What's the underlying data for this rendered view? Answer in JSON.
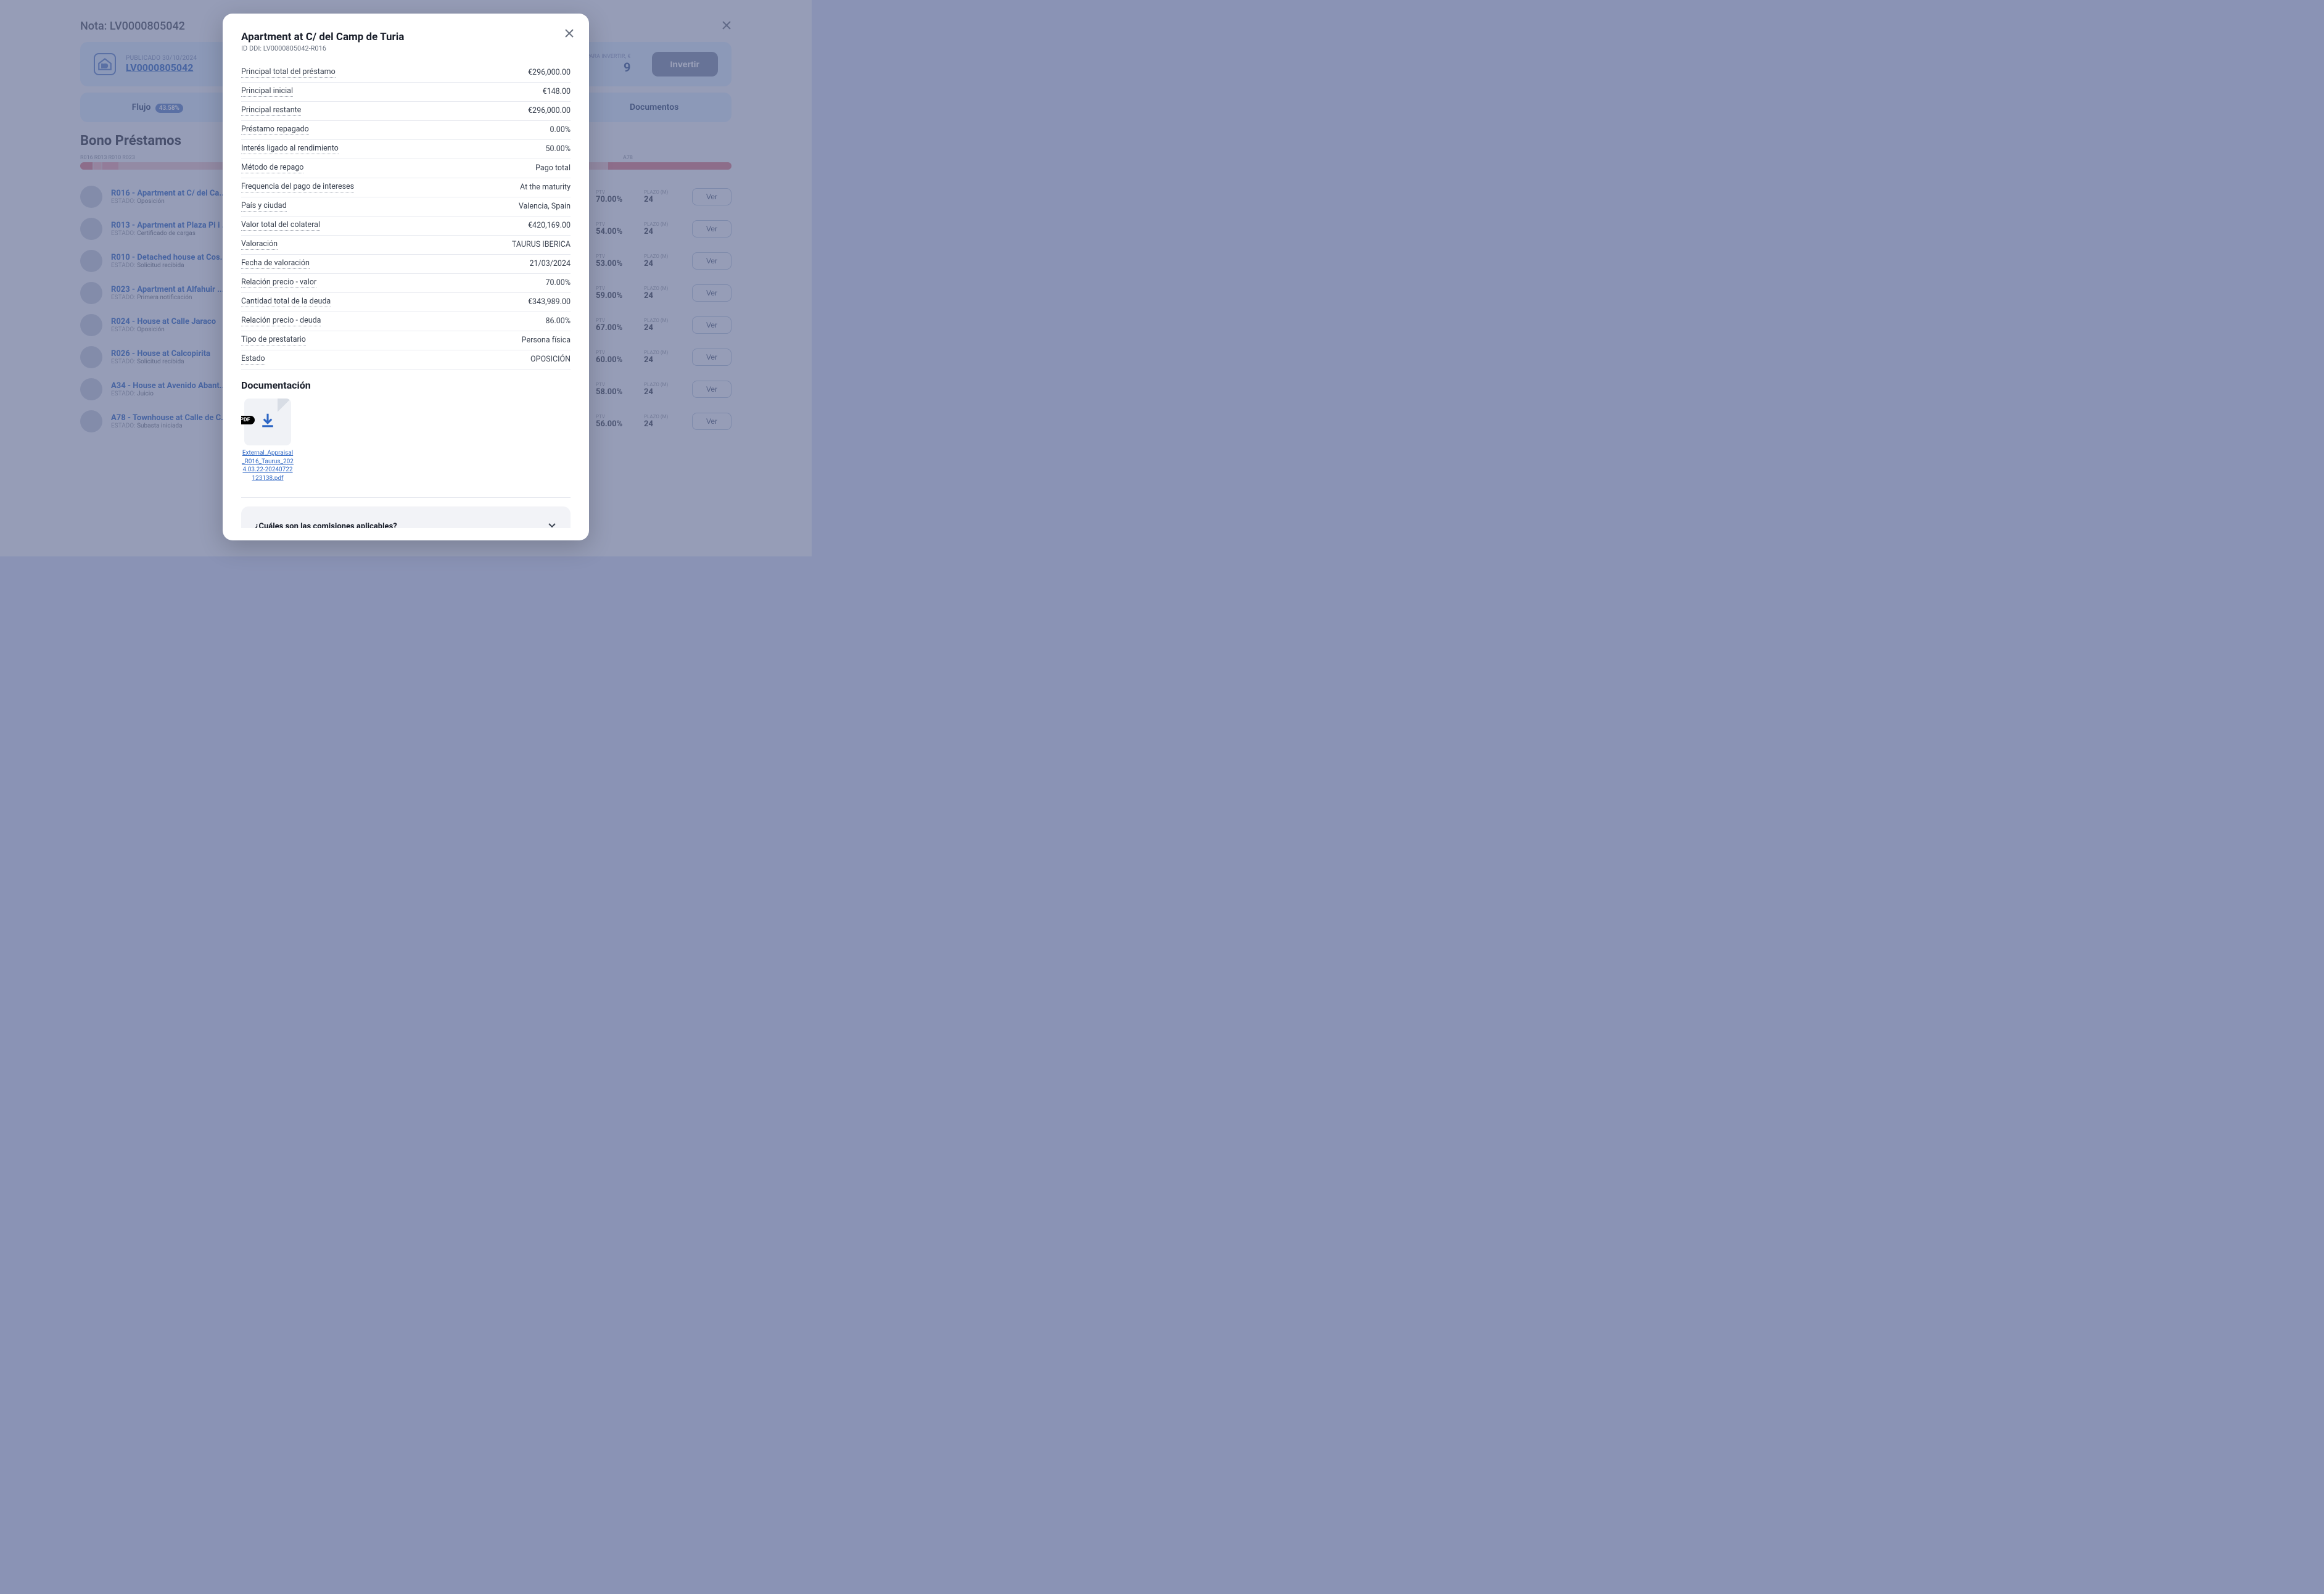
{
  "bg": {
    "nota_label": "Nota: LV0000805042",
    "publicado": "PUBLICADO 30/10/2024",
    "lv_link": "LV0000805042",
    "metric_label": "CANTIDAD DISPONIBLE PARA INVERTIR, €",
    "metric_value": "9",
    "invest": "Invertir",
    "tabs": {
      "flujo": "Flujo",
      "flujo_badge": "43.58%",
      "documentos": "Documentos"
    },
    "section": "Bono Préstamos",
    "timeline_labels": [
      "R016",
      "R013",
      "R010",
      "R023"
    ],
    "timeline_right": "A78",
    "ptv_label": "PTV",
    "plazo_label": "PLAZO (M)",
    "estado_label": "ESTADO:",
    "ver": "Ver",
    "loans": [
      {
        "title": "R016 - Apartment at C/ del Ca...",
        "status": "Oposición",
        "ptv": "70.00%",
        "plazo": "24"
      },
      {
        "title": "R013 - Apartment at Plaza Pi i ...",
        "status": "Certificado de cargas",
        "ptv": "54.00%",
        "plazo": "24"
      },
      {
        "title": "R010 - Detached house at Cos...",
        "status": "Solicitud recibida",
        "ptv": "53.00%",
        "plazo": "24"
      },
      {
        "title": "R023 - Apartment at Alfahuir ...",
        "status": "Primera notificación",
        "ptv": "59.00%",
        "plazo": "24"
      },
      {
        "title": "R024 - House at Calle Jaraco",
        "status": "Oposición",
        "ptv": "67.00%",
        "plazo": "24"
      },
      {
        "title": "R026 - House at Calcopirita",
        "status": "Solicitud recibida",
        "ptv": "60.00%",
        "plazo": "24"
      },
      {
        "title": "A34 - House at Avenido Abant...",
        "status": "Juicio",
        "ptv": "58.00%",
        "plazo": "24"
      },
      {
        "title": "A78 - Townhouse at Calle de C...",
        "status": "Subasta iniciada",
        "ptv": "56.00%",
        "plazo": "24"
      }
    ]
  },
  "modal": {
    "title": "Apartment at C/ del Camp de Turia",
    "subtitle": "ID DDI: LV0000805042-R016",
    "details": [
      {
        "label": "Principal total del préstamo",
        "value": "€296,000.00"
      },
      {
        "label": "Principal inicial",
        "value": "€148.00"
      },
      {
        "label": "Principal restante",
        "value": "€296,000.00"
      },
      {
        "label": "Préstamo repagado",
        "value": "0.00%"
      },
      {
        "label": "Interés ligado al rendimiento",
        "value": "50.00%"
      },
      {
        "label": "Método de repago",
        "value": "Pago total"
      },
      {
        "label": "Frequencia del pago de intereses",
        "value": "At the maturity"
      },
      {
        "label": "País y ciudad",
        "value": "Valencia, Spain"
      },
      {
        "label": "Valor total del colateral",
        "value": "€420,169.00"
      },
      {
        "label": "Valoración",
        "value": "TAURUS IBERICA"
      },
      {
        "label": "Fecha de valoración",
        "value": "21/03/2024"
      },
      {
        "label": "Relación precio - valor",
        "value": "70.00%"
      },
      {
        "label": "Cantidad total de la deuda",
        "value": "€343,989.00"
      },
      {
        "label": "Relación precio - deuda",
        "value": "86.00%"
      },
      {
        "label": "Tipo de prestatario",
        "value": "Persona física"
      },
      {
        "label": "Estado",
        "value": "OPOSICIÓN"
      }
    ],
    "doc_heading": "Documentación",
    "doc_badge": "PDF",
    "doc_name": "External_Appraisal_R016_Taurus_2024.03.22-20240722123138.pdf",
    "faq": "¿Cuáles son las comisiones aplicables?"
  }
}
